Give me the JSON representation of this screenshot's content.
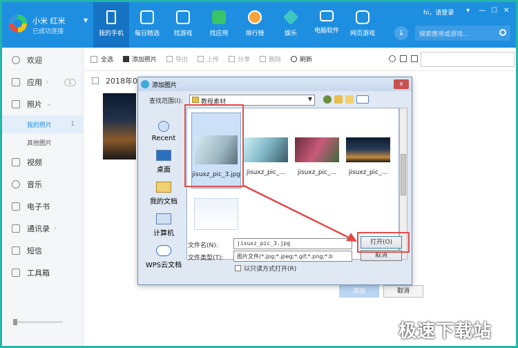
{
  "brand": {
    "name": "小米 红米",
    "status": "已成功连接"
  },
  "nav": [
    {
      "label": "我的手机",
      "icon": "phone-icon"
    },
    {
      "label": "每日精选",
      "icon": "calendar-icon"
    },
    {
      "label": "找游戏",
      "icon": "gamepad-icon"
    },
    {
      "label": "找应用",
      "icon": "shopping-bag-icon"
    },
    {
      "label": "排行榜",
      "icon": "medal-icon"
    },
    {
      "label": "娱乐",
      "icon": "diamond-icon"
    },
    {
      "label": "电脑软件",
      "icon": "monitor-icon"
    },
    {
      "label": "网页游戏",
      "icon": "controller-icon"
    }
  ],
  "window": {
    "login": "hi，请登录",
    "search_placeholder": "搜索應用或游戏..."
  },
  "sidebar": {
    "items": [
      {
        "label": "欢迎"
      },
      {
        "label": "应用",
        "badge": "1"
      },
      {
        "label": "照片"
      },
      {
        "label": "视频"
      },
      {
        "label": "音乐"
      },
      {
        "label": "电子书"
      },
      {
        "label": "通讯录"
      },
      {
        "label": "短信"
      },
      {
        "label": "工具箱"
      }
    ],
    "photo_subs": [
      {
        "label": "我的照片",
        "count": "1"
      },
      {
        "label": "其他图片"
      }
    ]
  },
  "toolbar": {
    "select_all": "全选",
    "add_photo": "添加照片",
    "export": "导出",
    "upload": "上传",
    "share": "分享",
    "delete": "删除",
    "refresh": "刷新"
  },
  "main": {
    "date": "2018年02",
    "add_btn": "添加",
    "cancel_btn": "取消"
  },
  "dialog": {
    "title": "添加图片",
    "close": "x",
    "look_in_label": "查找范围(I):",
    "look_in_value": "教程素材",
    "places": [
      "Recent",
      "桌面",
      "我的文档",
      "计算机",
      "WPS云文档"
    ],
    "files": [
      {
        "name": "jisuxz_pic_3.jpg"
      },
      {
        "name": "jisuxz_pic_..."
      },
      {
        "name": "jisuxz_pic_..."
      },
      {
        "name": "jisuxz_pic_..."
      }
    ],
    "filename_label": "文件名(N):",
    "filename_value": "jisuxz_pic_3.jpg",
    "filetype_label": "文件类型(T):",
    "filetype_value": "图片文件(*.jpg;*.jpeg;*.gif;*.png;*.b",
    "readonly_label": "以只读方式打开(R)",
    "open_btn": "打开(O)",
    "cancel_btn": "取消"
  },
  "watermark": "极速下载站",
  "colors": {
    "topbar": "#1e8fe0",
    "frame": "#23b5a8",
    "highlight": "#e34a4a"
  }
}
